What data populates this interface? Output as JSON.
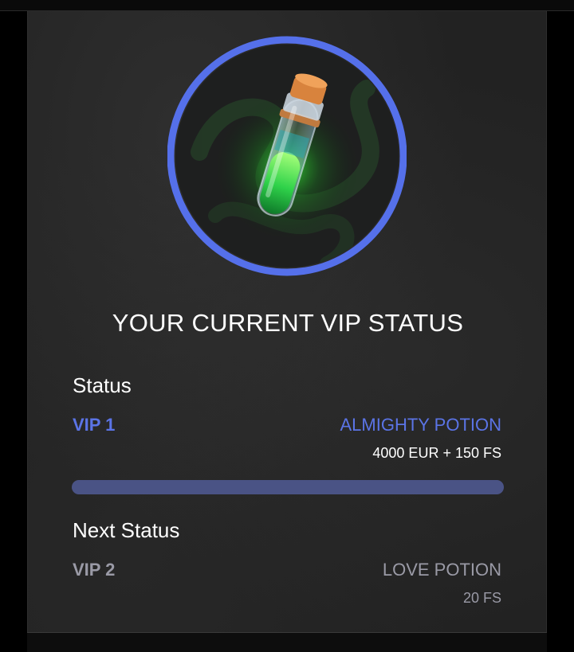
{
  "colors": {
    "accent": "#5b74e6",
    "muted": "#9a9aa6",
    "text": "#ffffff",
    "progress_track": "#3f4775"
  },
  "emblem": {
    "icon": "potion-bottle-icon",
    "ring_color": "#5570ea"
  },
  "title": "YOUR CURRENT VIP STATUS",
  "current": {
    "label": "Status",
    "level": "VIP 1",
    "reward_name": "ALMIGHTY POTION",
    "reward_value": "4000 EUR + 150 FS"
  },
  "progress": {
    "fraction": 1.0
  },
  "next": {
    "label": "Next Status",
    "level": "VIP 2",
    "reward_name": "LOVE POTION",
    "reward_value": "20 FS"
  }
}
